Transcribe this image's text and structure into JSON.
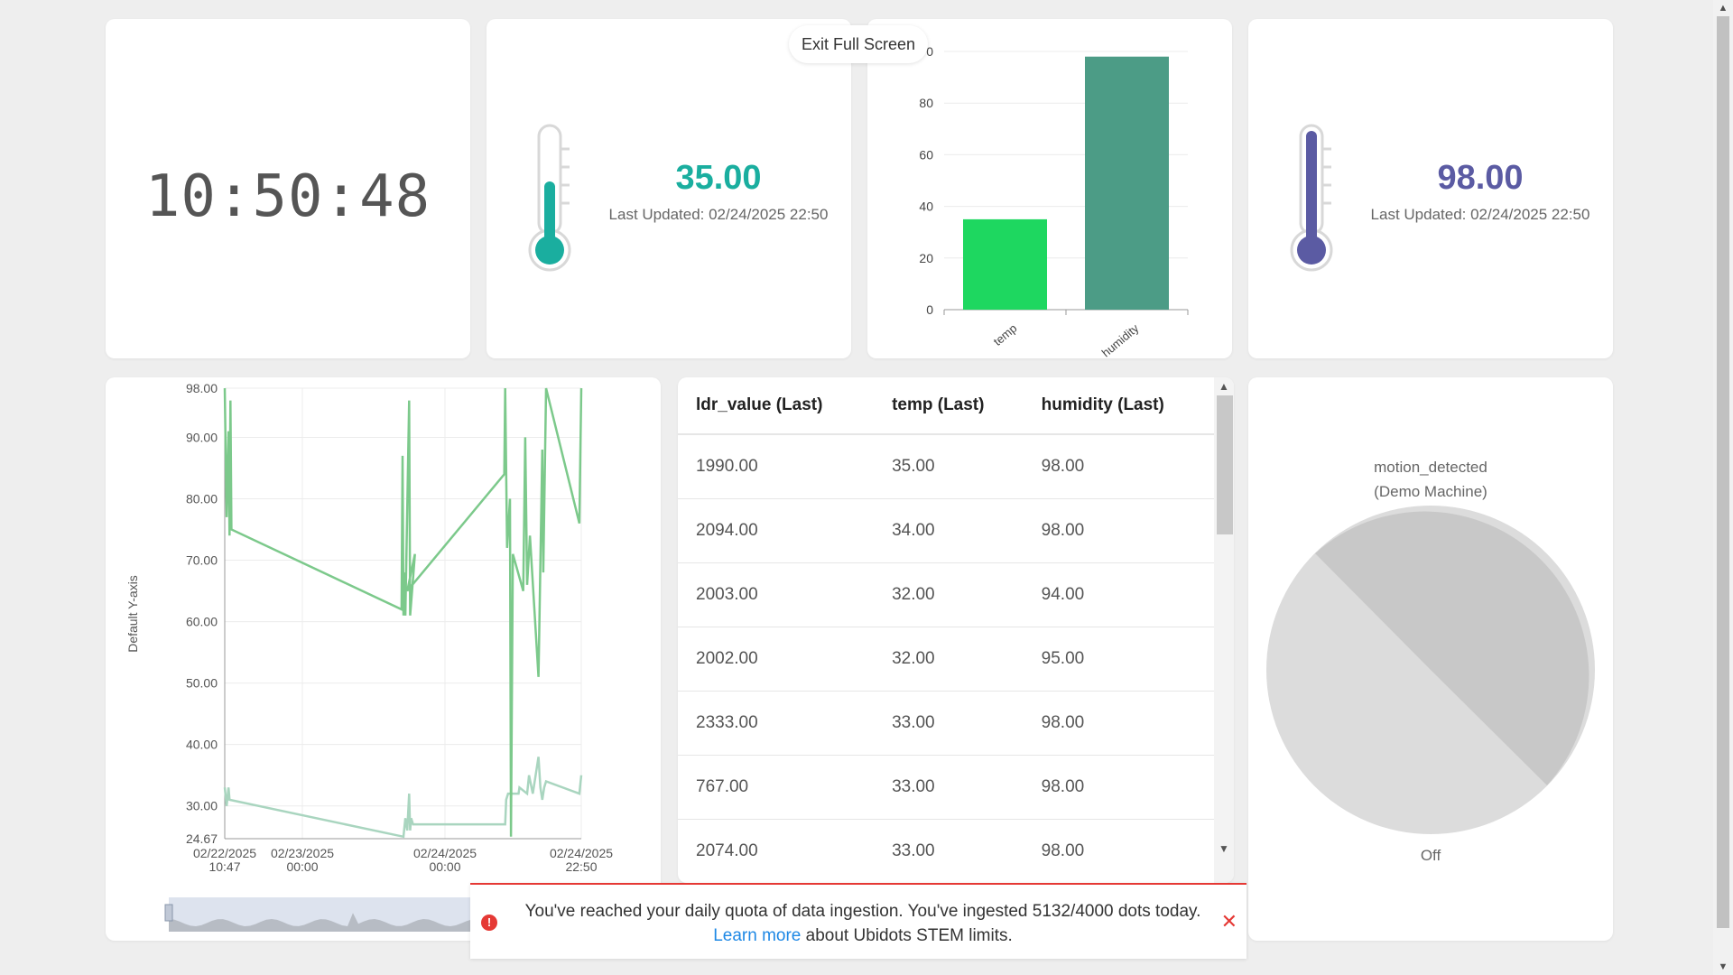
{
  "clock": {
    "time": "10:50:48"
  },
  "temp_widget": {
    "value": "35.00",
    "updated": "Last Updated: 02/24/2025 22:50",
    "color": "#1aae9f"
  },
  "humidity_widget": {
    "value": "98.00",
    "updated": "Last Updated: 02/24/2025 22:50",
    "color": "#5b5ba3"
  },
  "exit_fullscreen": {
    "label": "Exit Full Screen"
  },
  "bar_chart": {
    "chart_data": {
      "type": "bar",
      "categories": [
        "temp",
        "humidity"
      ],
      "values": [
        35,
        98
      ],
      "ylim": [
        0,
        100
      ],
      "yticks": [
        "0",
        "20",
        "40",
        "60",
        "80",
        "0"
      ],
      "colors": [
        "#1ed760",
        "#4c9c86"
      ]
    }
  },
  "line_chart": {
    "ylabel": "Default Y-axis",
    "yticks": [
      "98.00",
      "90.00",
      "80.00",
      "70.00",
      "60.00",
      "50.00",
      "40.00",
      "30.00",
      "24.67"
    ],
    "xticks": [
      {
        "date": "02/22/2025",
        "time": "10:47"
      },
      {
        "date": "02/23/2025",
        "time": "00:00"
      },
      {
        "date": "02/24/2025",
        "time": "00:00"
      },
      {
        "date": "02/24/2025",
        "time": "22:50"
      }
    ]
  },
  "table": {
    "headers": [
      "ldr_value (Last)",
      "temp (Last)",
      "humidity (Last)"
    ],
    "rows": [
      [
        "1990.00",
        "35.00",
        "98.00"
      ],
      [
        "2094.00",
        "34.00",
        "98.00"
      ],
      [
        "2003.00",
        "32.00",
        "94.00"
      ],
      [
        "2002.00",
        "32.00",
        "95.00"
      ],
      [
        "2333.00",
        "33.00",
        "98.00"
      ],
      [
        "767.00",
        "33.00",
        "98.00"
      ],
      [
        "2074.00",
        "33.00",
        "98.00"
      ]
    ]
  },
  "pie": {
    "title": "motion_detected",
    "subtitle": "(Demo Machine)",
    "label": "Off"
  },
  "toast": {
    "message_a": "You've reached your daily quota of data ingestion. You've ingested 5132/4000 dots today.",
    "link": "Learn more",
    "message_b": "about Ubidots STEM limits.",
    "icon": "!",
    "close": "✕"
  }
}
